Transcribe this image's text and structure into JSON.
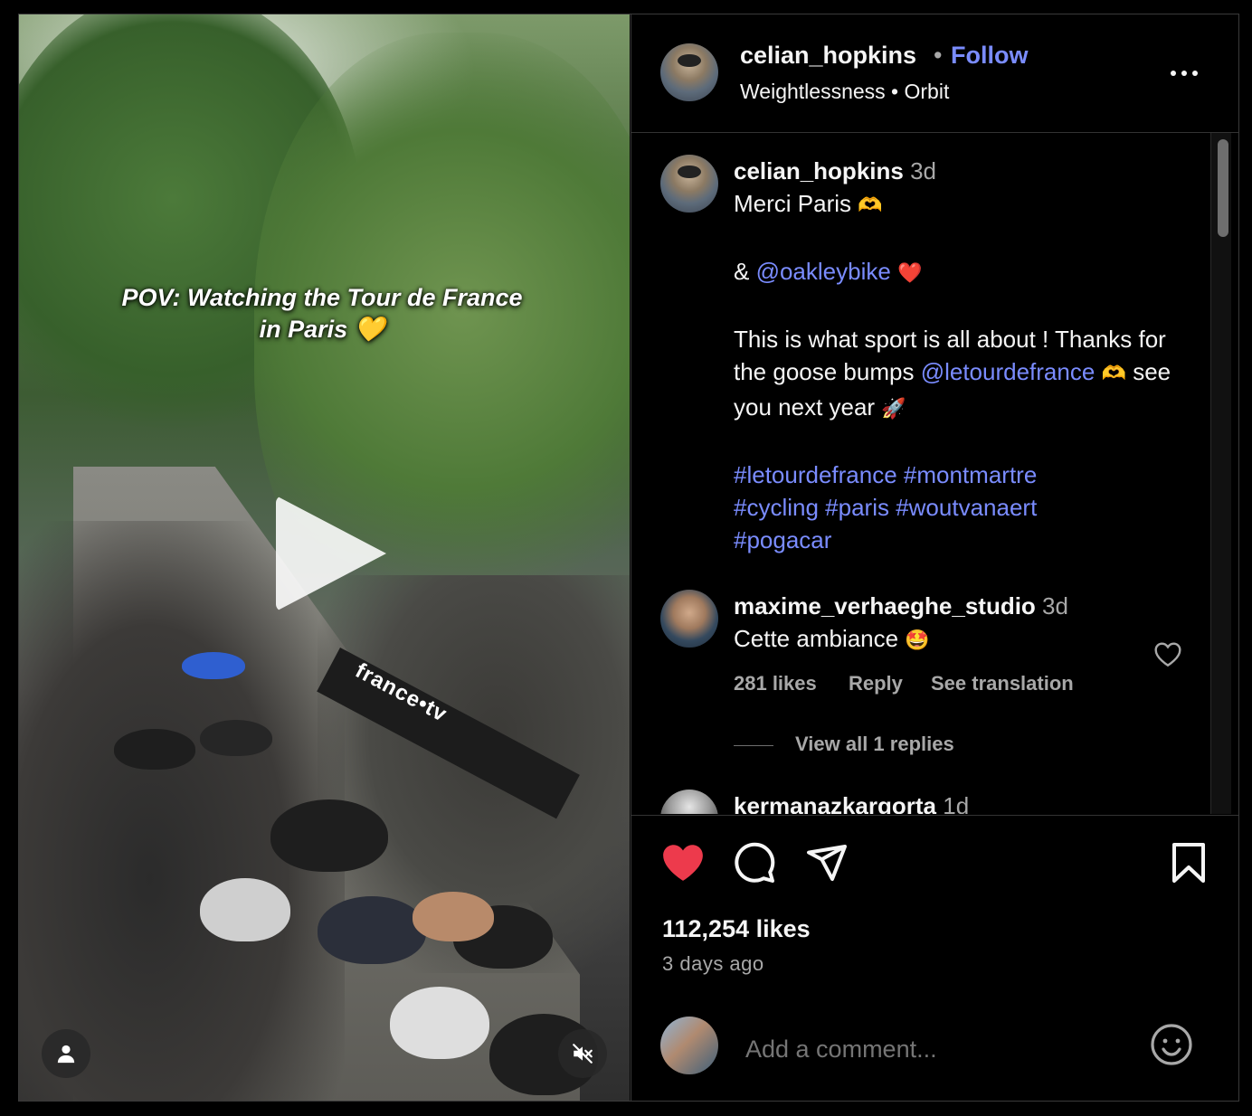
{
  "media": {
    "overlay_text": "POV: Watching the Tour de France in Paris 💛",
    "barrier_text": "france•tv",
    "play_icon": "play-icon",
    "profile_icon": "person-icon",
    "mute_icon": "speaker-muted-icon"
  },
  "header": {
    "username": "celian_hopkins",
    "separator": "•",
    "follow_label": "Follow",
    "audio_title": "Weightlessness",
    "audio_sep": "•",
    "audio_artist": "Orbit",
    "more_icon": "more-horizontal-icon"
  },
  "caption": {
    "username": "celian_hopkins",
    "time": "3d",
    "line1": "Merci Paris",
    "line1_emoji": "🫶",
    "amp": "&",
    "mention1": "@oakleybike",
    "heart_emoji": "❤️",
    "para": "This is what sport is all about ! Thanks for the goose bumps",
    "mention2": "@letourdefrance",
    "para2_emoji": "🫶",
    "para2": "see you next year",
    "rocket_emoji": "🚀",
    "hashtags1": "#letourdefrance #montmartre",
    "hashtags2": "#cycling #paris #woutvanaert",
    "hashtags3": "#pogacar"
  },
  "comments": [
    {
      "username": "maxime_verhaeghe_studio",
      "time": "3d",
      "text": "Cette ambiance",
      "emoji": "🤩",
      "likes": "281 likes",
      "reply": "Reply",
      "translate": "See translation",
      "view_replies": "View all 1 replies"
    },
    {
      "username": "kermanazkargorta",
      "time": "1d"
    }
  ],
  "actions": {
    "like_icon": "heart-filled-icon",
    "comment_icon": "comment-icon",
    "share_icon": "send-icon",
    "save_icon": "bookmark-icon",
    "likes": "112,254 likes",
    "posted": "3 days ago"
  },
  "add_comment": {
    "placeholder": "Add a comment...",
    "emoji_icon": "smiley-icon"
  },
  "colors": {
    "accent_link": "#7a8cff",
    "like_red": "#ed3a4c",
    "muted_text": "#a8a8a8",
    "background": "#000000"
  }
}
